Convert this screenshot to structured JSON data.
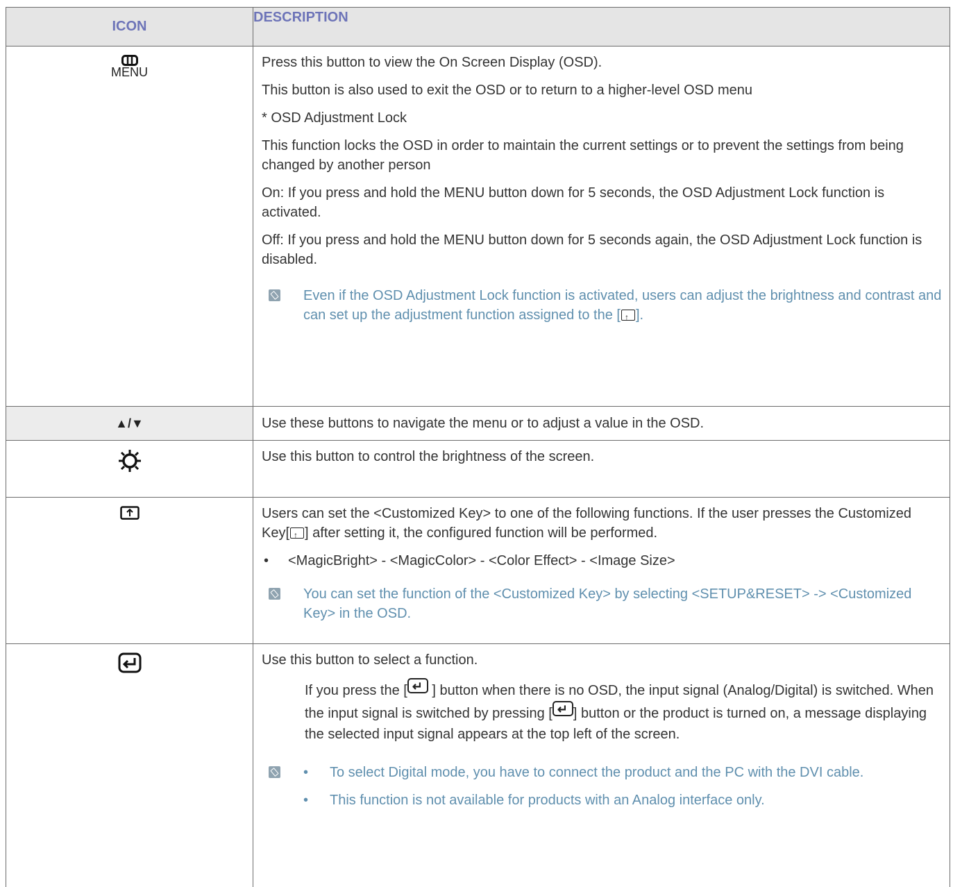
{
  "header": {
    "icon": "ICON",
    "description": "DESCRIPTION"
  },
  "rows": {
    "menu": {
      "icon_name": "menu-icon",
      "icon_label": "MENU",
      "paragraphs": [
        "Press this button to view the On Screen Display (OSD).",
        "This button is also used to exit the OSD or to return to a higher-level OSD menu",
        "* OSD Adjustment Lock",
        "This function locks the OSD in order to maintain the current settings or to prevent the settings from being changed by another person",
        "On: If you press and hold the MENU button down for 5 seconds, the OSD Adjustment Lock function is activated.",
        "Off: If you press and hold the MENU button down for 5 seconds again, the OSD Adjustment Lock function is disabled."
      ],
      "note_before": "Even if the OSD Adjustment Lock function is activated, users can adjust the brightness and contrast and can set up the adjustment function assigned to the [",
      "note_after": "]."
    },
    "updown": {
      "icon_label": "▲/▼",
      "text": "Use these buttons to navigate the menu or to adjust a value in the OSD."
    },
    "brightness": {
      "icon_name": "brightness-icon",
      "text": "Use this button to control the brightness of the screen."
    },
    "customized": {
      "icon_name": "customized-key-icon",
      "text_before": "Users can set the <Customized Key> to one of the following functions. If the user presses the Customized Key[",
      "text_after": "] after setting it, the configured function will be performed.",
      "bullet": "<MagicBright> - <MagicColor> - <Color Effect> - <Image Size>",
      "note": "You can set the function of the <Customized Key> by selecting <SETUP&RESET> -> <Customized Key> in the OSD."
    },
    "enter": {
      "icon_name": "enter-icon",
      "text": "Use this button to select a function.",
      "detail_1": "If you press the [",
      "detail_2": " ] button when there is no OSD, the input signal (Analog/Digital) is switched. When the input signal is switched by pressing [",
      "detail_3": "] button or the product is turned on, a message displaying the selected input signal appears at the top left of the screen.",
      "notes": [
        "To select Digital mode, you have to connect the product and the PC with the DVI cable.",
        "This function is not available for products with an Analog interface only."
      ]
    }
  },
  "bullet_char": "•"
}
